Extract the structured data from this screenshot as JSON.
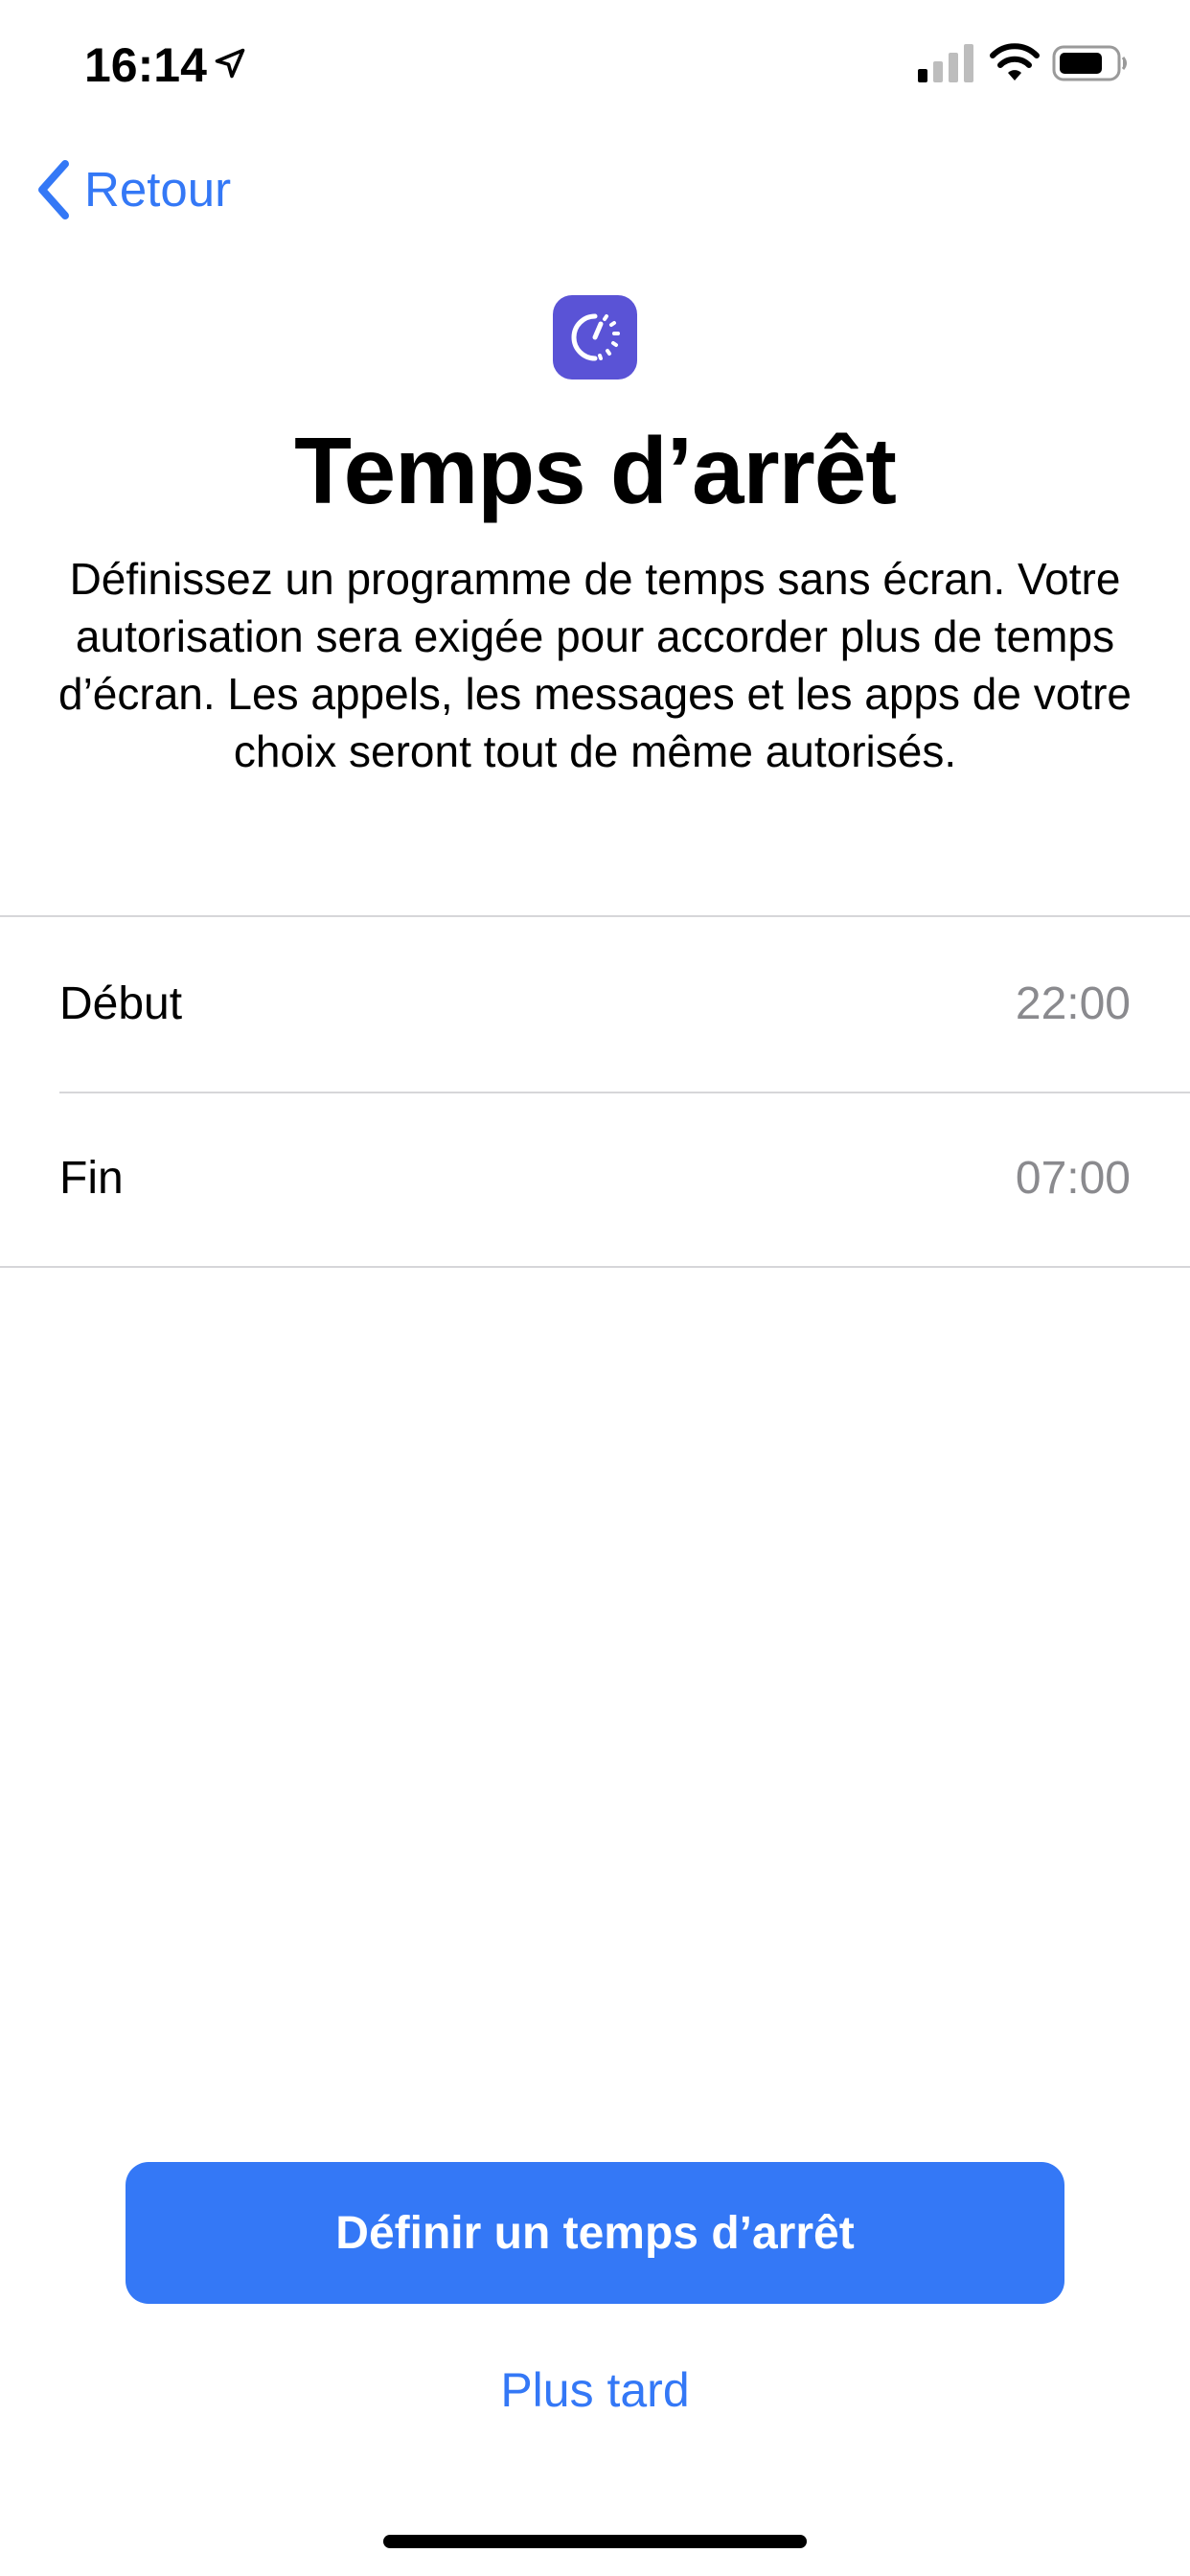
{
  "status_bar": {
    "time": "16:14",
    "icons": [
      "location-arrow-icon",
      "cellular-signal-icon",
      "wifi-icon",
      "battery-icon"
    ]
  },
  "nav": {
    "back_label": "Retour",
    "back_icon": "chevron-left-icon"
  },
  "header": {
    "icon": "screen-time-downtime-icon",
    "title": "Temps d’arrêt",
    "description": "Définissez un programme de temps sans écran. Votre autorisation sera exigée pour accorder plus de temps d’écran. Les appels, les messages et les apps de votre choix seront tout de même autorisés."
  },
  "schedule": {
    "rows": [
      {
        "label": "Début",
        "value": "22:00"
      },
      {
        "label": "Fin",
        "value": "07:00"
      }
    ]
  },
  "actions": {
    "primary_label": "Définir un temps d’arrêt",
    "secondary_label": "Plus tard"
  },
  "colors": {
    "accent": "#3478F6",
    "icon_bg": "#5A53D6",
    "secondary_text": "#8A8A8E",
    "separator": "#D6D6D9"
  }
}
